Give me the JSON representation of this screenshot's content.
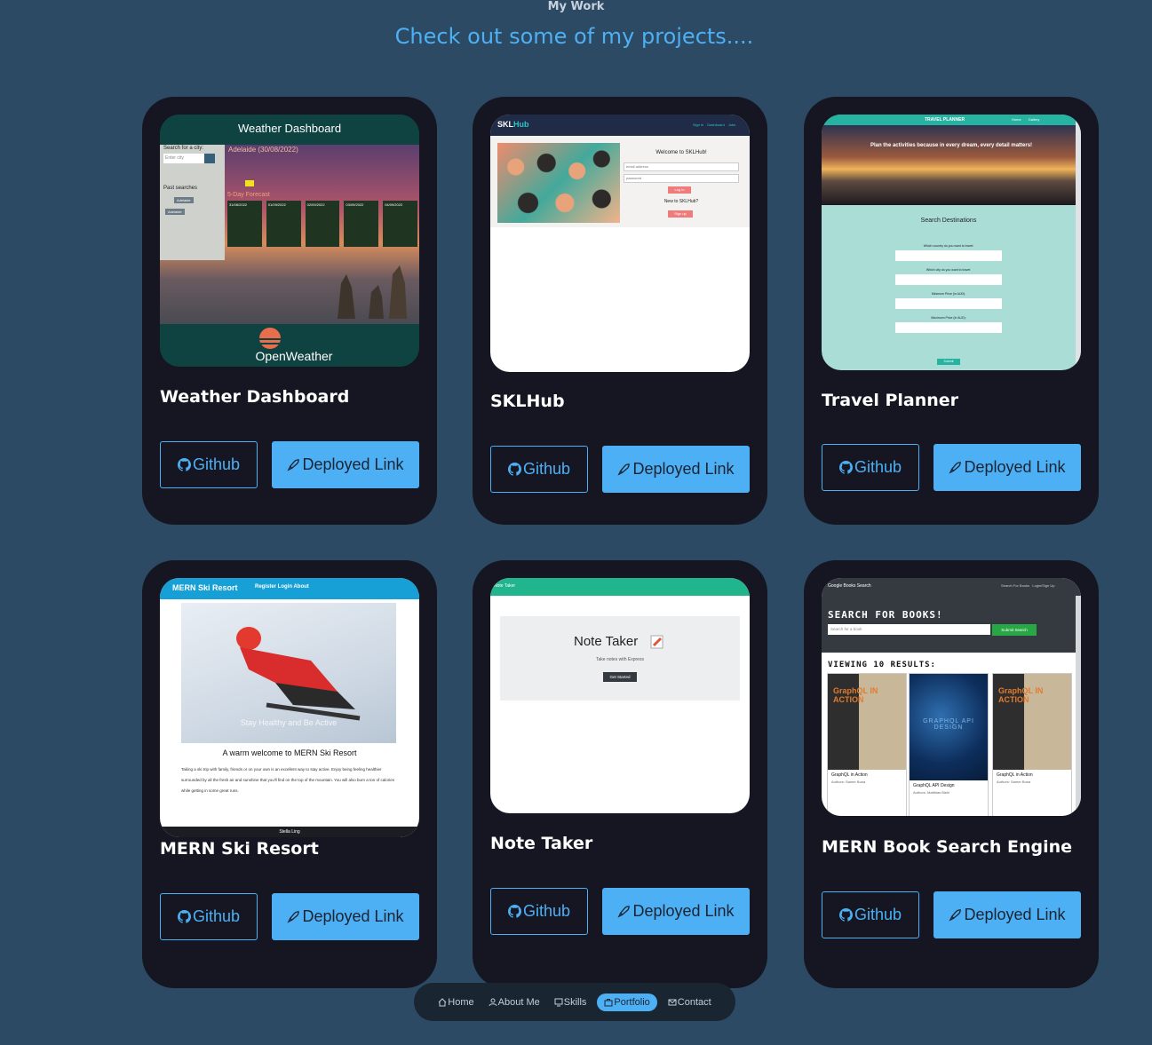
{
  "header": {
    "kicker": "My Work",
    "headline": "Check out some of my projects...."
  },
  "projects": [
    {
      "title": "Weather Dashboard",
      "github_label": "Github",
      "deployed_label": "Deployed Link",
      "thumb": {
        "header_title": "Weather Dashboard",
        "search_label": "Search for a city:",
        "search_placeholder": "Enter city",
        "city_line": "Adelaide (30/08/2022)",
        "past_label": "Past searches",
        "past_items": [
          "Adelaide",
          "Adelaide"
        ],
        "forecast_label": "5-Day Forecast",
        "forecast_dates": [
          "31/08/2022",
          "01/09/2022",
          "02/09/2022",
          "03/09/2022",
          "04/09/2022"
        ],
        "brand": "OpenWeather"
      }
    },
    {
      "title": "SKLHub",
      "github_label": "Github",
      "deployed_label": "Deployed Link",
      "thumb": {
        "brand_a": "SKL",
        "brand_b": "Hub",
        "nav": [
          "Sign in",
          "Dashboard",
          "Jobs"
        ],
        "welcome": "Welcome to SKLHub!",
        "email_placeholder": "email address",
        "password_placeholder": "password",
        "login": "Log in",
        "new_to": "New to SKLHub?",
        "signup": "Sign up"
      }
    },
    {
      "title": "Travel Planner",
      "github_label": "Github",
      "deployed_label": "Deployed Link",
      "thumb": {
        "brand": "TRAVEL PLANNER",
        "nav": [
          "Home",
          "Gallery"
        ],
        "tagline": "Plan the activities because in every dream, every detail matters!",
        "section": "Search Destinations",
        "fields": [
          "Which country do you want to travel:",
          "Which city do you want to travel:",
          "Minimum Price (in AUD):",
          "Maximum Price (in AUD):"
        ],
        "submit": "Submit"
      }
    },
    {
      "title": "MERN Ski Resort",
      "github_label": "Github",
      "deployed_label": "Deployed Link",
      "thumb": {
        "brand": "MERN Ski Resort",
        "nav": "Register Login About",
        "overlay": "Stay Healthy and Be Active",
        "welcome": "A warm welcome to MERN Ski Resort",
        "body": "Taking a ski trip with family, friends or on your own is an excellent way to stay active. Enjoy being feeling healthier surrounded by all the fresh air and sunshine that you'll find on the top of the mountain. You will also burn a ton of calories while getting in some great runs.",
        "footer": "Stella Ling"
      }
    },
    {
      "title": "Note Taker",
      "github_label": "Github",
      "deployed_label": "Deployed Link",
      "thumb": {
        "brand": "Note Taker",
        "heading": "Note Taker",
        "sub": "Take notes with Express",
        "cta": "Get Started"
      }
    },
    {
      "title": "MERN Book Search Engine",
      "github_label": "Github",
      "deployed_label": "Deployed Link",
      "thumb": {
        "brand": "Google Books Search",
        "nav": "Search For Books   Login/Sign Up",
        "search_heading": "SEARCH FOR BOOKS!",
        "search_placeholder": "Search for a book",
        "submit": "Submit Search",
        "results": "VIEWING 10 RESULTS:",
        "books": [
          {
            "cover": "GraphQL IN ACTION",
            "title": "GraphQL in Action",
            "author": "Authors: Samer Buna"
          },
          {
            "cover": "GRAPHQL API DESIGN",
            "title": "GraphQL API Design",
            "author": "Authors: Matthias Biehl"
          },
          {
            "cover": "GraphQL IN ACTION",
            "title": "GraphQL in Action",
            "author": "Authors: Samer Buna"
          }
        ]
      }
    }
  ],
  "nav": {
    "items": [
      {
        "label": "Home",
        "icon": "home-icon"
      },
      {
        "label": "About Me",
        "icon": "user-icon"
      },
      {
        "label": "Skills",
        "icon": "monitor-icon"
      },
      {
        "label": "Portfolio",
        "icon": "briefcase-icon",
        "active": true
      },
      {
        "label": "Contact",
        "icon": "mail-icon"
      }
    ]
  },
  "colors": {
    "background": "#2c4a63",
    "card": "#151622",
    "accent": "#4db0f4"
  }
}
